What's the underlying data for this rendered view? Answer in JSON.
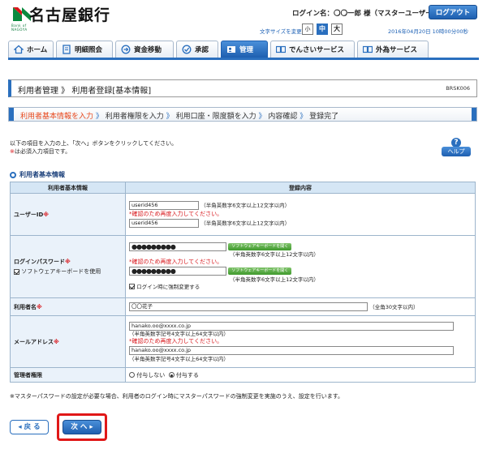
{
  "header": {
    "bank_name": "名古屋銀行",
    "logo_text": "Bank of NAGOYA",
    "login_name": "ログイン名：〇〇一郎 様（マスターユーザー）",
    "logout_label": "ログアウト",
    "font_size_label": "文字サイズを変更",
    "font_small": "小",
    "font_medium": "中",
    "font_large": "大",
    "datetime": "2016年04月20日 10時00分00秒"
  },
  "nav": {
    "tabs": [
      {
        "label": "ホーム"
      },
      {
        "label": "明細照会"
      },
      {
        "label": "資金移動"
      },
      {
        "label": "承認"
      },
      {
        "label": "管理"
      },
      {
        "label": "でんさいサービス"
      },
      {
        "label": "外為サービス"
      }
    ]
  },
  "page": {
    "title": "利用者管理 》 利用者登録[基本情報]",
    "code": "BRSK006"
  },
  "steps": {
    "s1": "利用者基本情報を入力",
    "s2": "利用者権限を入力",
    "s3": "利用口座・限度額を入力",
    "s4": "内容確認",
    "s5": "登録完了",
    "sep": "》"
  },
  "instructions": {
    "line1": "以下の項目を入力の上、「次へ」ボタンをクリックしてください。",
    "mark": "※",
    "line2": "は必須入力項目です。"
  },
  "help_label": "ヘルプ",
  "help_q": "?",
  "section_title": "利用者基本情報",
  "table": {
    "col1": "利用者基本情報",
    "col2": "登録内容",
    "req_mark": "※",
    "user_id_label": "ユーザーID",
    "user_id_value": "userid456",
    "user_id_hint": "（半角英数字6文字以上12文字以内）",
    "user_id_confirm": "userid456",
    "confirm_warning": "*確認のため再度入力してください。",
    "password_label": "ログインパスワード",
    "kb_checkbox_label": "ソフトウェアキーボードを使用",
    "password_mask": "●●●●●●●●●",
    "kb_button": "ソフトウェアキーボードを開く",
    "password_hint": "（半角英数字6文字以上12文字以内）",
    "force_change_label": "ログイン時に強制変更する",
    "name_label": "利用者名",
    "name_value": "〇〇花子",
    "name_hint": "（全角30文字以内）",
    "email_label": "メールアドレス",
    "email_value": "hanako.oo@xxxx.co.jp",
    "email_hint": "（半角英数字記号4文字以上64文字以内）",
    "admin_label": "管理者権限",
    "admin_opt_no": "付与しない",
    "admin_opt_yes": "付与する"
  },
  "footnote": "※マスターパスワードの設定が必要な場合、利用者のログイン時にマスターパスワードの強制変更を実施のうえ、設定を行います。",
  "buttons": {
    "back": "◂ 戻 る",
    "next": "次 へ ▸"
  },
  "colors": {
    "accent": "#2a6fbe",
    "step_current": "#e8491d",
    "required": "#d8161b",
    "highlight_frame": "#e01818"
  }
}
